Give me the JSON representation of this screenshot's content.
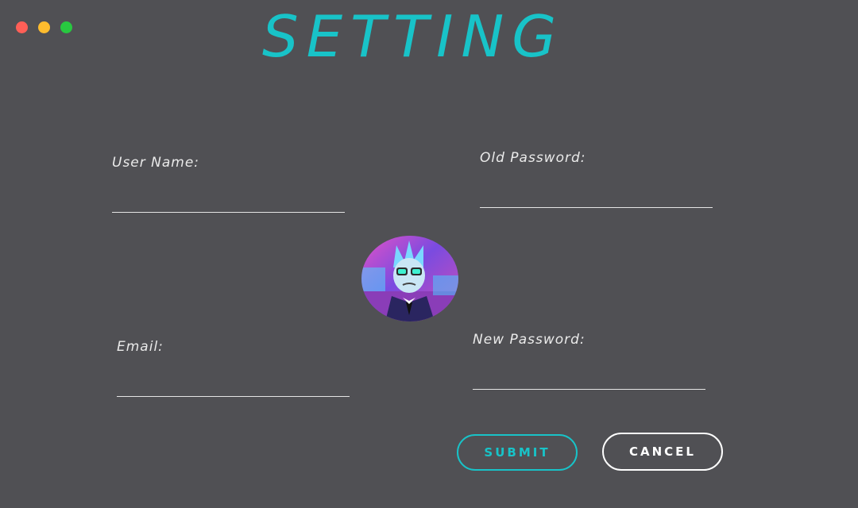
{
  "window": {
    "controls": [
      "close",
      "minimize",
      "maximize"
    ],
    "title": "SETTING"
  },
  "form": {
    "username": {
      "label": "User Name:",
      "value": ""
    },
    "old_password": {
      "label": "Old Password:",
      "value": ""
    },
    "email": {
      "label": "Email:",
      "value": ""
    },
    "new_password": {
      "label": "New Password:",
      "value": ""
    }
  },
  "avatar": {
    "icon": "profile-avatar-image"
  },
  "buttons": {
    "submit": "SUBMIT",
    "cancel": "CANCEL"
  },
  "colors": {
    "background": "#505054",
    "accent": "#18c3c8",
    "text": "#eaeaea"
  }
}
